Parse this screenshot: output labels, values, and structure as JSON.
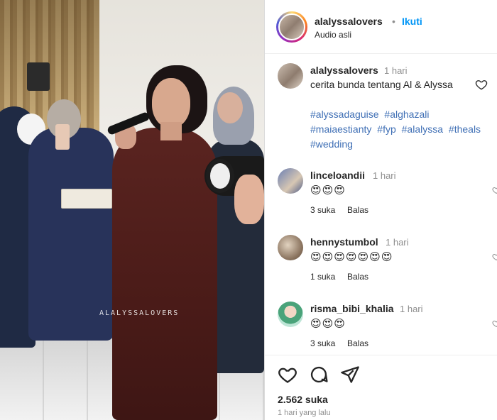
{
  "media": {
    "watermark": "ALALYSSALOVERS"
  },
  "header": {
    "username": "alalyssalovers",
    "separator": "•",
    "follow_label": "Ikuti",
    "audio_label": "Audio asli"
  },
  "caption": {
    "username": "alalyssalovers",
    "time": "1 hari",
    "text": "cerita bunda tentang Al & Alyssa",
    "hashtags": [
      "#alyssadaguise",
      "#alghazali",
      "#maiaestianty",
      "#fyp",
      "#alalyssa",
      "#theals",
      "#wedding"
    ]
  },
  "comments": [
    {
      "username": "linceloandii",
      "time": "1 hari",
      "emoji": "😍😍😍",
      "likes": "3 suka",
      "reply_label": "Balas"
    },
    {
      "username": "hennystumbol",
      "time": "1 hari",
      "emoji": "😍😍😍😍😍😍😍",
      "likes": "1 suka",
      "reply_label": "Balas"
    },
    {
      "username": "risma_bibi_khalia",
      "time": "1 hari",
      "emoji": "😍😍😍",
      "likes": "3 suka",
      "reply_label": "Balas"
    }
  ],
  "footer": {
    "likes_count": "2.562 suka",
    "date": "1 hari yang lalu"
  },
  "icons": {
    "like": "heart-icon",
    "comment": "comment-icon",
    "share": "share-icon"
  },
  "colors": {
    "link_blue": "#0095f6",
    "hashtag": "#3f6fb5",
    "muted": "#8e8e8e"
  }
}
